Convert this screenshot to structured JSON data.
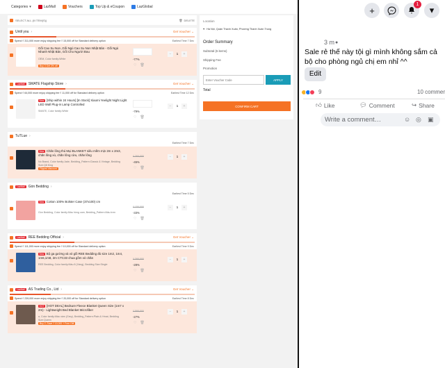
{
  "topnav": {
    "categories": "Categories",
    "links": [
      {
        "label": "LazMall",
        "color": "#d0011b"
      },
      {
        "label": "Vouchers",
        "color": "#f57224"
      },
      {
        "label": "Top Up & eCoupon",
        "color": "#1a9cb7"
      },
      {
        "label": "LazGlobal",
        "color": "#2d7be5"
      }
    ]
  },
  "selectbar": {
    "select_all": "SELECT ALL (8 ITEM(S))",
    "delete": "DELETE"
  },
  "shops": [
    {
      "name": "Until you",
      "laz_badge": "",
      "get_voucher": "Get Voucher",
      "progress": 0.25,
      "spend": "Spend ₫ 311,000 more enjoy shipping fee ₫ 15,000 off for Standard delivery option",
      "eta": "Earliest Time 7 Dec",
      "item": {
        "highlight": true,
        "badge": "",
        "title": "Gối Cao Su Non ,Gối Ngủ Cao Su Non Nhật Bản - Gối Ngủ Nhanh Nhật Bản, Gối Cho Người Đau",
        "variant": "OEM, Color family:White",
        "promo": "Buy 3 Get 3% off",
        "old_price": "",
        "discount": "-77%",
        "qty": "1",
        "thumb": "#ffffff"
      }
    },
    {
      "name": "SMATE Flagship Store",
      "laz_badge": "LazMall",
      "get_voucher": "Get Voucher",
      "progress": 0.3,
      "spend": "Spend ₫ 64,000 more enjoy shipping fee ₫ 11,000 off for Standard delivery option",
      "eta": "Earliest Time 12 Dec",
      "item": {
        "highlight": false,
        "badge": "New",
        "title": "[Ship within 24 Hours] [In Stock] Xiaomi Yeelight Night Light LED Wall Plug-in Lamp Controlled",
        "variant": "SMATE, Color family:White",
        "promo": "",
        "old_price": "",
        "discount": "-79%",
        "qty": "1",
        "thumb": "#f3f3f3"
      }
    },
    {
      "name": "TuTLue",
      "laz_badge": "",
      "get_voucher": "",
      "progress": 0,
      "spend": "",
      "eta": "Earliest Time 7 Dec",
      "item": {
        "highlight": true,
        "badge": "New",
        "title": "Chăn lông thú Mụi BLANKET siêu mềm mịn 2m x 2m3, chăn lông xù, chăn lông cừu, chăn lông",
        "variant": "No Brand, Color family:Jade, Bedding_Pattern:Classic & Vintage, Bedding Size:Q8 King",
        "promo": "Flipped discount",
        "old_price": "₫ 260,000",
        "discount": "-45%",
        "qty": "1",
        "thumb": "#1e2a38"
      }
    },
    {
      "name": "Gòn Bedding",
      "laz_badge": "LazMall",
      "get_voucher": "",
      "progress": 0,
      "spend": "",
      "eta": "Earliest Time 5 Dec",
      "item": {
        "highlight": false,
        "badge": "New",
        "title": "Cotton 100% Bolster Case (37x100) cm",
        "variant": "Gòn Bedding, Color family:Màu hồng cam, Bedding_Pattern:Màu trơn",
        "promo": "",
        "old_price": "₫ 150,000",
        "discount": "-33%",
        "qty": "1",
        "thumb": "#f2a3a0"
      }
    },
    {
      "name": "REE Bedding Official",
      "laz_badge": "LazMall",
      "get_voucher": "Get Voucher",
      "progress": 0.35,
      "spend": "Spend ₫ 111,000 more enjoy shipping fee ₫ 10,000 off for Standard delivery option",
      "eta": "Earliest Time 9 Dec",
      "item": {
        "highlight": true,
        "badge": "New",
        "title": "Bộ ga gường và vỏ gối REE Bedding đủ size 1m2, 1m4, 1m6,1m8, 2m CTC33 chua gồm vỏ chăn",
        "variant": "REE Bedding, Color family:Màu 8 (Vàng), Bedding Size:Single",
        "promo": "",
        "old_price": "₫ 390,000",
        "discount": "-28%",
        "qty": "1",
        "thumb": "#2f5f9e"
      }
    },
    {
      "name": "AS Trading Co., Ltd",
      "laz_badge": "LazMall",
      "get_voucher": "Get Voucher",
      "progress": 0.22,
      "spend": "Spend ₫ 239,000 more enjoy shipping fee ₫ 20,000 off for Standard delivery option",
      "eta": "Earliest Time 8 Dec",
      "item": {
        "highlight": true,
        "badge": "HOT",
        "title": "[HOT DEAL] Bedsure Fleece Blanket Queen Size (1m7 x 2m) - Lightweight Bed Blanket Microfiber",
        "variant": "a, Color family:Màu xám (Grey), Bedding_Pattern:Plain & Hmat, Bedding Size:Queen",
        "promo": "Buy 2, Save ₫ 10,000 + Free Gift",
        "old_price": "₫ 590,000",
        "discount": "-27%",
        "qty": "1",
        "thumb": "#6e5a4e"
      }
    }
  ],
  "summary": {
    "location_label": "Location",
    "location": "Hà Nội, Quận Thanh Xuân, Phường Thanh Xuân Trung",
    "title": "Order Summary",
    "subtotal": "Subtotal (6 items)",
    "shipping": "Shipping Fee",
    "promotion": "Promotion",
    "voucher_placeholder": "Enter Voucher Code",
    "apply": "APPLY",
    "total": "Total",
    "confirm": "CONFIRM CART"
  },
  "facebook": {
    "notif_count": "1",
    "time": "3 m",
    "text": "Sale rẻ thế này tội gì mình không sắm cả bộ cho phòng ngủ chị em nhỉ ^^",
    "edit": "Edit",
    "reaction_count": "9",
    "comment_count": "10 comments",
    "like": "Like",
    "comment": "Comment",
    "share": "Share",
    "write_placeholder": "Write a comment…",
    "accent": "#1877f2"
  }
}
